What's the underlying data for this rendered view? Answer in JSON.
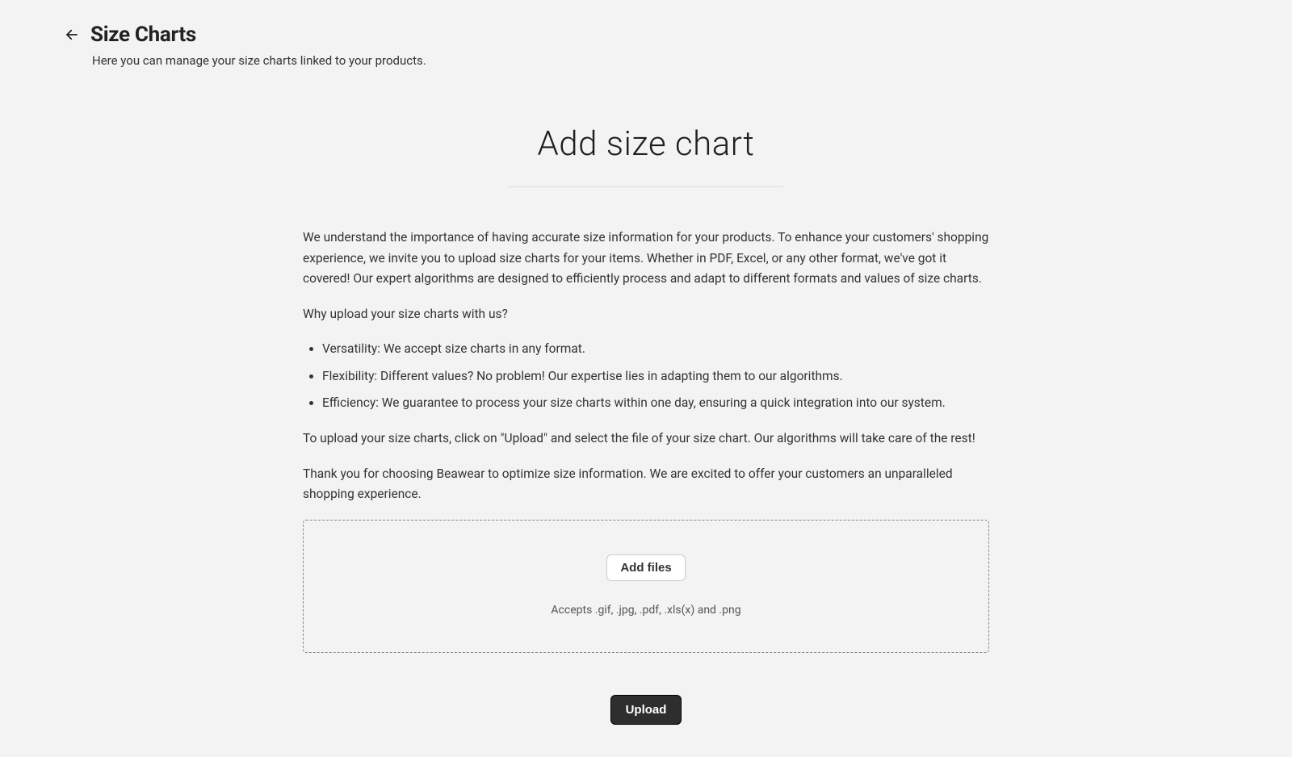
{
  "header": {
    "title": "Size Charts",
    "subtitle": "Here you can manage your size charts linked to your products."
  },
  "main": {
    "heading": "Add size chart",
    "intro": "We understand the importance of having accurate size information for your products. To enhance your customers' shopping experience, we invite you to upload size charts for your items. Whether in PDF, Excel, or any other format, we've got it covered! Our expert algorithms are designed to efficiently process and adapt to different formats and values of size charts.",
    "why_heading": "Why upload your size charts with us?",
    "bullets": [
      "Versatility: We accept size charts in any format.",
      "Flexibility: Different values? No problem! Our expertise lies in adapting them to our algorithms.",
      "Efficiency: We guarantee to process your size charts within one day, ensuring a quick integration into our system."
    ],
    "howto": "To upload your size charts, click on \"Upload\" and select the file of your size chart. Our algorithms will take care of the rest!",
    "thanks": "Thank you for choosing Beawear to optimize size information. We are excited to offer your customers an unparalleled shopping experience."
  },
  "dropzone": {
    "add_files_label": "Add files",
    "accepts": "Accepts .gif, .jpg, .pdf, .xls(x) and .png"
  },
  "actions": {
    "upload_label": "Upload"
  }
}
